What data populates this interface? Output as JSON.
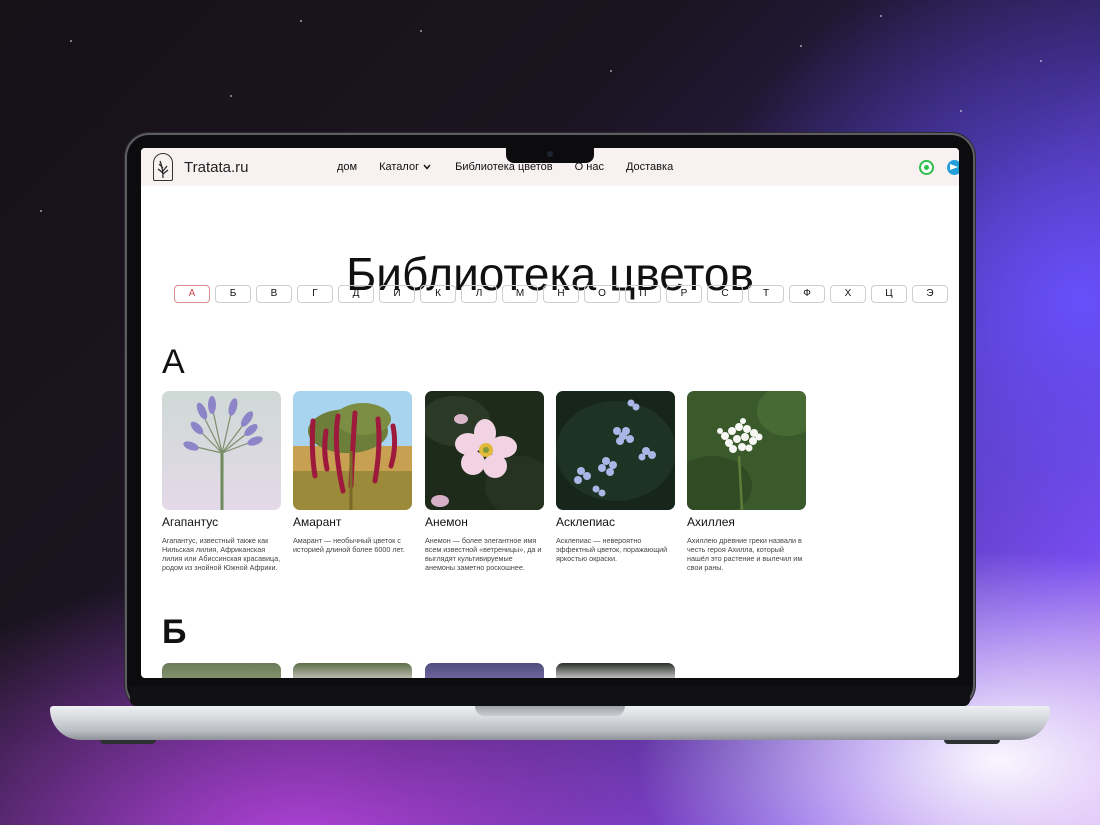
{
  "site": {
    "logo_text": "Tratata.ru"
  },
  "nav": {
    "links": [
      "дом",
      "Каталог",
      "Библиотека цветов",
      "О нас",
      "Доставка"
    ]
  },
  "page": {
    "title": "Библиотека цветов"
  },
  "alphabet": [
    "А",
    "Б",
    "В",
    "Г",
    "Д",
    "И",
    "К",
    "Л",
    "М",
    "Н",
    "О",
    "П",
    "Р",
    "С",
    "Т",
    "Ф",
    "Х",
    "Ц",
    "Э"
  ],
  "active_letter": "А",
  "sections": [
    {
      "letter": "А",
      "items": [
        {
          "name": "Агапантус",
          "desc": "Агапантус, известный также как Нильская лилия, Африканская лилия или Абиссинская красавица, родом из знойной Южной Африки."
        },
        {
          "name": "Амарант",
          "desc": "Амарант — необычный цветок с историей длиной более 6000 лет."
        },
        {
          "name": "Анемон",
          "desc": "Анемон — более элегантное имя всем известной «ветреницы», да и выглядят культивируемые анемоны заметно роскошнее."
        },
        {
          "name": "Асклепиас",
          "desc": "Асклепиас — невероятно эффектный цветок, поражающий яркостью окраски."
        },
        {
          "name": "Ахиллея",
          "desc": "Ахиллею древние греки назвали в честь героя Ахилла, который нашёл это растение и вылечил им свои раны."
        }
      ]
    },
    {
      "letter": "Б"
    }
  ],
  "colors": {
    "accent": "#c9474d",
    "nav_bg": "#f8f1f1",
    "whatsapp": "#2fbf4b",
    "telegram": "#229ed9"
  },
  "icons": [
    "logo-icon",
    "chevron-down-icon",
    "whatsapp-icon",
    "telegram-icon"
  ]
}
